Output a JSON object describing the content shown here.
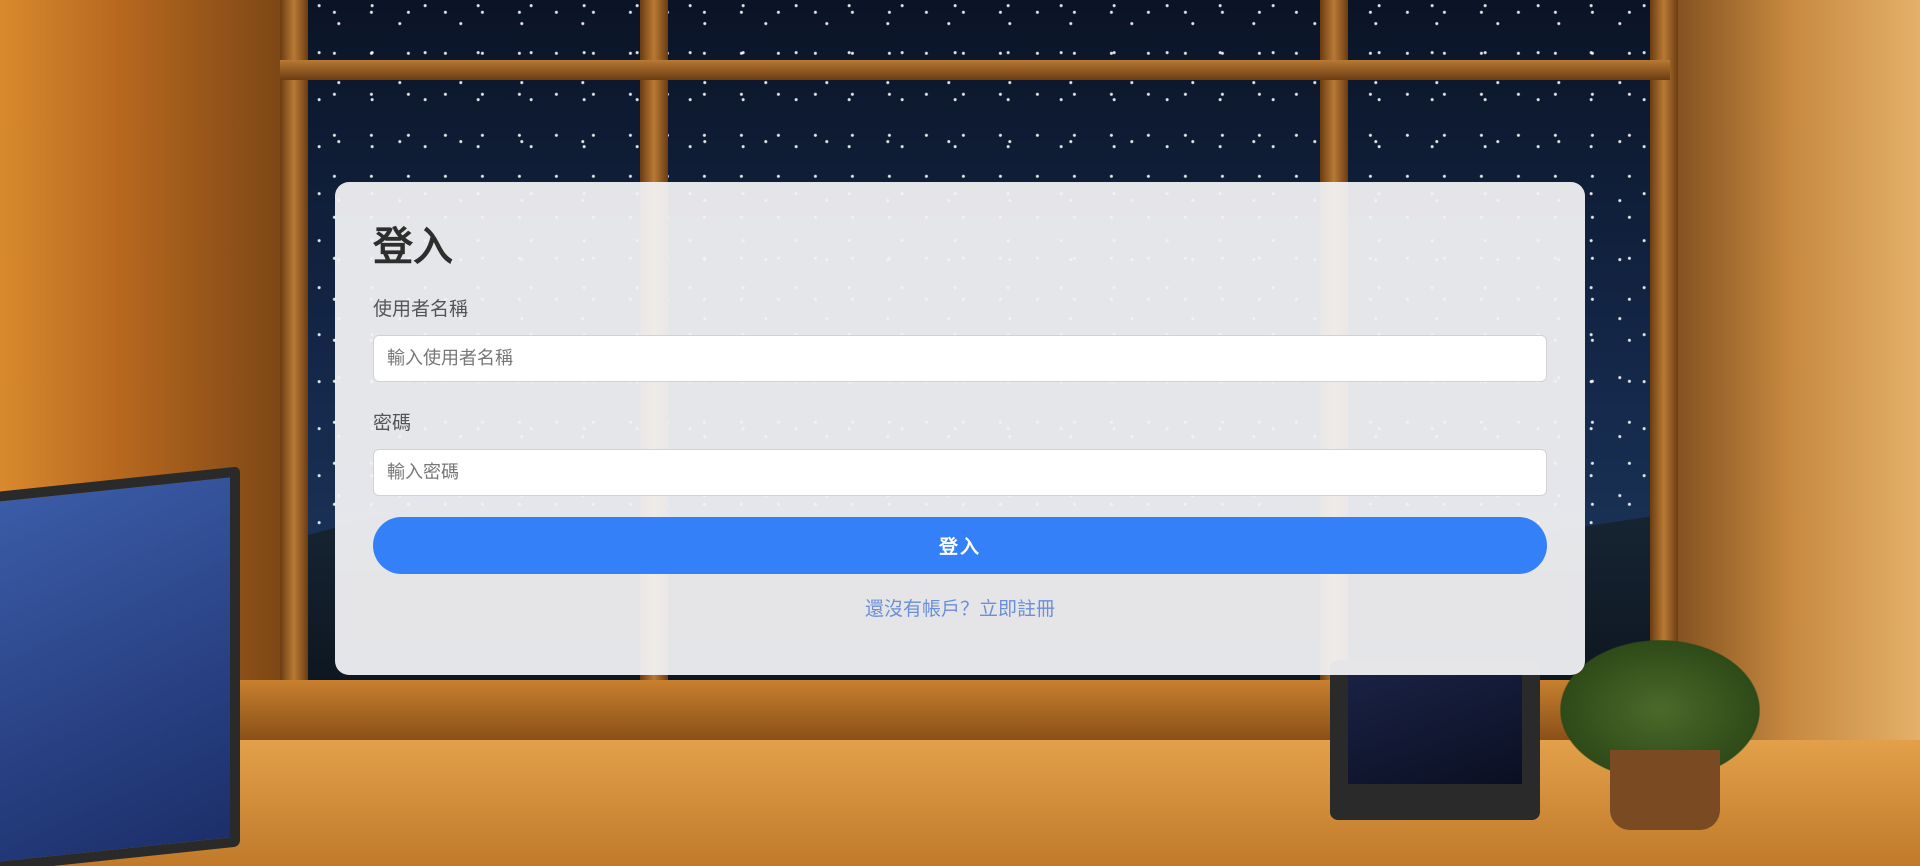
{
  "login": {
    "title": "登入",
    "username_label": "使用者名稱",
    "username_placeholder": "輸入使用者名稱",
    "username_value": "",
    "password_label": "密碼",
    "password_placeholder": "輸入密碼",
    "password_value": "",
    "submit_label": "登入",
    "register_link": "還沒有帳戶？立即註冊"
  },
  "colors": {
    "primary_button": "#3480f8",
    "link": "#6b8fd6",
    "card_background": "#f2f2f4",
    "title_text": "#2e2e2e"
  }
}
